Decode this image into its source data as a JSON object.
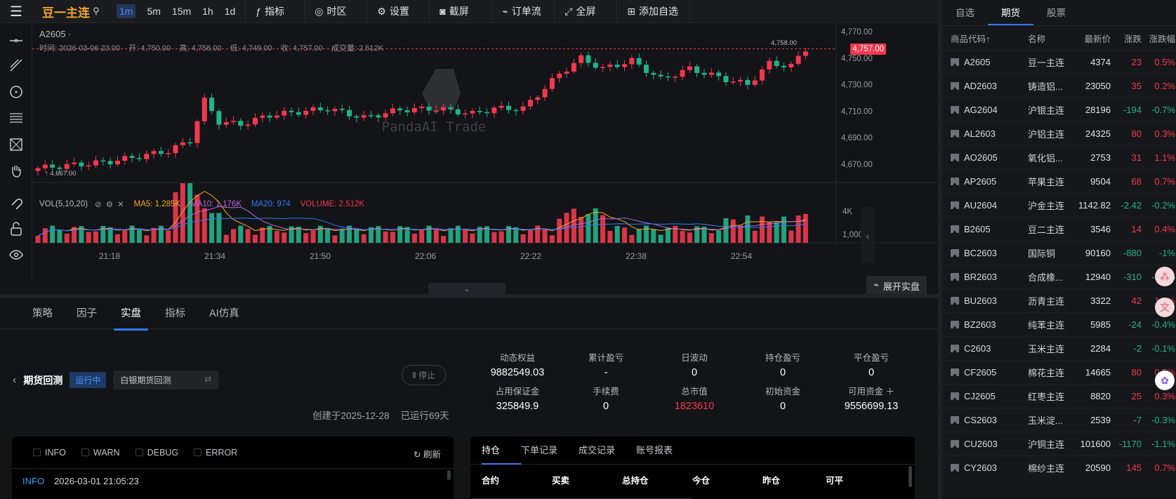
{
  "toolbar": {
    "symbol": "豆一主连",
    "timeframes": [
      "1m",
      "5m",
      "15m",
      "1h",
      "1d"
    ],
    "active_timeframe": "1m",
    "buttons": [
      "指标",
      "时区",
      "设置",
      "截屏",
      "订单流",
      "全屏",
      "添加自选"
    ]
  },
  "chart": {
    "symbol_label": "A2605 ·",
    "ohlc": {
      "time_label": "时间",
      "time": "2026-03-06 23:00",
      "open_label": "开",
      "open": "4,750.00",
      "high_label": "高",
      "high": "4,758.00",
      "low_label": "低",
      "low": "4,749.00",
      "close_label": "收",
      "close": "4,757.00",
      "volume_label": "成交量",
      "volume": "2.512K"
    },
    "price_axis": [
      "4,770.00",
      "4,750.00",
      "4,730.00",
      "4,710.00",
      "4,690.00",
      "4,670.00"
    ],
    "last_price": "4,757.00",
    "high_marker": "4,758.00",
    "low_marker": "4,667.00",
    "watermark": "PandaAI Trade",
    "time_axis": [
      "21:18",
      "21:34",
      "21:50",
      "22:06",
      "22:22",
      "22:38",
      "22:54"
    ],
    "volume_axis": [
      "4K",
      "1,000"
    ],
    "volume_legend": {
      "title": "VOL(5,10,20)",
      "ma5": "MA5: 1.285K",
      "ma10": "MA10: 1.176K",
      "ma20": "MA20: 974",
      "volume": "VOLUME: 2.512K"
    },
    "colors": {
      "up": "#f2384f",
      "down": "#22b38a",
      "ma5": "#f5a623",
      "ma10": "#b36bdc",
      "ma20": "#2f7bff",
      "background": "#131417"
    },
    "expand_button": "展开实盘"
  },
  "watchlist": {
    "tabs": [
      "自选",
      "期货",
      "股票"
    ],
    "active_tab": "期货",
    "headers": [
      "商品代码↑",
      "名称",
      "最新价",
      "涨跌",
      "涨跌幅"
    ],
    "rows": [
      {
        "code": "A2605",
        "name": "豆一主连",
        "price": "4374",
        "chg": "23",
        "pct": "0.5%",
        "dir": "up"
      },
      {
        "code": "AD2603",
        "name": "铸造铝...",
        "price": "23050",
        "chg": "35",
        "pct": "0.2%",
        "dir": "up"
      },
      {
        "code": "AG2604",
        "name": "沪银主连",
        "price": "28196",
        "chg": "-194",
        "pct": "-0.7%",
        "dir": "dn"
      },
      {
        "code": "AL2603",
        "name": "沪铝主连",
        "price": "24325",
        "chg": "80",
        "pct": "0.3%",
        "dir": "up"
      },
      {
        "code": "AO2605",
        "name": "氧化铝...",
        "price": "2753",
        "chg": "31",
        "pct": "1.1%",
        "dir": "up"
      },
      {
        "code": "AP2605",
        "name": "苹果主连",
        "price": "9504",
        "chg": "68",
        "pct": "0.7%",
        "dir": "up"
      },
      {
        "code": "AU2604",
        "name": "沪金主连",
        "price": "1142.82",
        "chg": "-2.42",
        "pct": "-0.2%",
        "dir": "dn"
      },
      {
        "code": "B2605",
        "name": "豆二主连",
        "price": "3546",
        "chg": "14",
        "pct": "0.4%",
        "dir": "up"
      },
      {
        "code": "BC2603",
        "name": "国际铜",
        "price": "90160",
        "chg": "-880",
        "pct": "-1%",
        "dir": "dn"
      },
      {
        "code": "BR2603",
        "name": "合成橡...",
        "price": "12940",
        "chg": "-310",
        "pct": "-2.2%",
        "dir": "dn"
      },
      {
        "code": "BU2603",
        "name": "沥青主连",
        "price": "3322",
        "chg": "42",
        "pct": "1.3%",
        "dir": "up"
      },
      {
        "code": "BZ2603",
        "name": "纯苯主连",
        "price": "5985",
        "chg": "-24",
        "pct": "-0.4%",
        "dir": "dn"
      },
      {
        "code": "C2603",
        "name": "玉米主连",
        "price": "2284",
        "chg": "-2",
        "pct": "-0.1%",
        "dir": "dn"
      },
      {
        "code": "CF2605",
        "name": "棉花主连",
        "price": "14665",
        "chg": "80",
        "pct": "0.5%",
        "dir": "up"
      },
      {
        "code": "CJ2605",
        "name": "红枣主连",
        "price": "8820",
        "chg": "25",
        "pct": "0.3%",
        "dir": "up"
      },
      {
        "code": "CS2603",
        "name": "玉米淀...",
        "price": "2539",
        "chg": "-7",
        "pct": "-0.3%",
        "dir": "dn"
      },
      {
        "code": "CU2603",
        "name": "沪铜主连",
        "price": "101600",
        "chg": "-1170",
        "pct": "-1.1%",
        "dir": "dn"
      },
      {
        "code": "CY2603",
        "name": "棉纱主连",
        "price": "20590",
        "chg": "145",
        "pct": "0.7%",
        "dir": "up"
      }
    ]
  },
  "bottom": {
    "tabs": [
      "策略",
      "因子",
      "实盘",
      "指标",
      "AI仿真"
    ],
    "active_tab": "实盘",
    "strategy_title": "期货回测",
    "status": "运行中",
    "strategy_select": "白银期货回测",
    "stop_button": "停止",
    "created": "创建于2025-12-28",
    "running": "已运行69天",
    "stats": [
      {
        "label": "动态权益",
        "value": "9882549.03"
      },
      {
        "label": "累计盈亏",
        "value": "-"
      },
      {
        "label": "日波动",
        "value": "0"
      },
      {
        "label": "持仓盈亏",
        "value": "0"
      },
      {
        "label": "平仓盈亏",
        "value": "0"
      },
      {
        "label": "占用保证金",
        "value": "325849.9"
      },
      {
        "label": "手续费",
        "value": "0"
      },
      {
        "label": "总市值",
        "value": "1823610"
      },
      {
        "label": "初始资金",
        "value": "0"
      },
      {
        "label": "可用资金",
        "value": "9556699.13"
      }
    ],
    "log_filters": [
      "INFO",
      "WARN",
      "DEBUG",
      "ERROR"
    ],
    "refresh": "刷新",
    "log_level": "INFO",
    "log_time": "2026-03-01 21:05:23",
    "position_tabs": [
      "持仓",
      "下单记录",
      "成交记录",
      "账号报表"
    ],
    "position_headers": [
      "合约",
      "买卖",
      "总持仓",
      "今仓",
      "昨仓",
      "可平",
      ""
    ]
  }
}
